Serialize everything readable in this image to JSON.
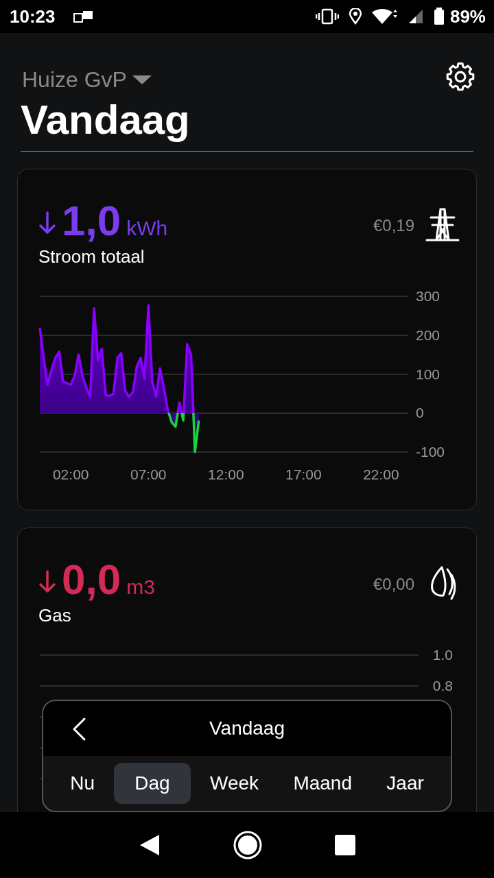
{
  "status_bar": {
    "time": "10:23",
    "battery": "89%"
  },
  "header": {
    "home": "Huize GvP",
    "title": "Vandaag"
  },
  "cards": [
    {
      "kind": "electricity",
      "decreasing": true,
      "value": "1,0",
      "unit": "kWh",
      "label": "Stroom totaal",
      "cost": "€0,19",
      "color": "#7b3cf0",
      "chart_data": {
        "type": "area",
        "grid": true,
        "xlim": [
          0,
          23.75
        ],
        "ylim": [
          -100,
          300
        ],
        "xticks": [
          {
            "value": 2,
            "label": "02:00"
          },
          {
            "value": 7,
            "label": "07:00"
          },
          {
            "value": 12,
            "label": "12:00"
          },
          {
            "value": 17,
            "label": "17:00"
          },
          {
            "value": 22,
            "label": "22:00"
          }
        ],
        "yticks": [
          300,
          200,
          100,
          0,
          -100
        ],
        "x": [
          0,
          0.25,
          0.5,
          0.75,
          1,
          1.25,
          1.5,
          1.75,
          2,
          2.25,
          2.5,
          2.75,
          3,
          3.25,
          3.5,
          3.75,
          4,
          4.25,
          4.5,
          4.75,
          5,
          5.25,
          5.5,
          5.75,
          6,
          6.25,
          6.5,
          6.75,
          7,
          7.25,
          7.5,
          7.75,
          8,
          8.25,
          8.5,
          8.75,
          9,
          9.25,
          9.5,
          9.75,
          10,
          10.25
        ],
        "series": [
          {
            "color": "#8800ff",
            "values": [
              219,
              142,
              73,
              111,
              142,
              158,
              81,
              77,
              73,
              96,
              150,
              96,
              65,
              42,
              269,
              135,
              165,
              46,
              44,
              50,
              142,
              154,
              58,
              42,
              54,
              119,
              142,
              88,
              277,
              81,
              42,
              115,
              65,
              8,
              -23,
              -35,
              27,
              -19,
              177,
              150,
              -100,
              -19
            ]
          }
        ]
      }
    },
    {
      "kind": "gas",
      "decreasing": true,
      "value": "0,0",
      "unit": "m3",
      "label": "Gas",
      "cost": "€0,00",
      "color": "#d42a56",
      "yticks": [
        "1.0",
        "0.8"
      ]
    }
  ],
  "period_picker": {
    "title": "Vandaag",
    "tabs": [
      {
        "label": "Nu",
        "selected": false
      },
      {
        "label": "Dag",
        "selected": true
      },
      {
        "label": "Week",
        "selected": false
      },
      {
        "label": "Maand",
        "selected": false
      },
      {
        "label": "Jaar",
        "selected": false
      }
    ]
  }
}
